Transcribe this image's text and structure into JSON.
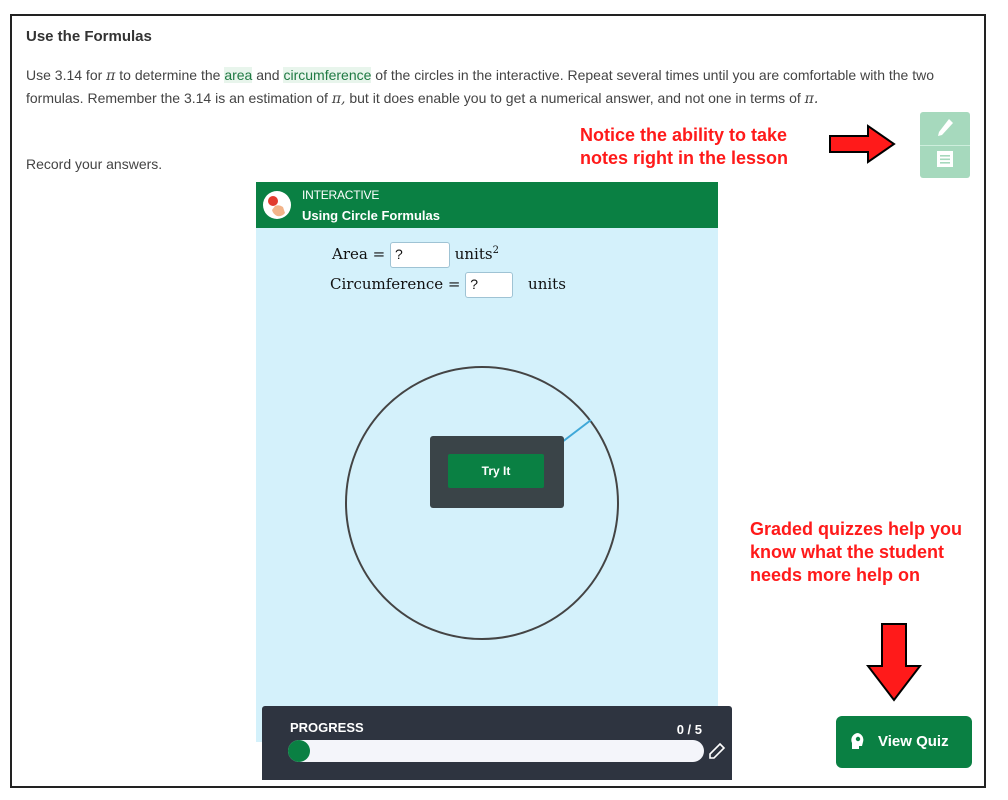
{
  "lesson": {
    "title": "Use the Formulas",
    "body_parts": {
      "p1": "Use 3.14 for ",
      "pi1": "π",
      "p2": " to determine the ",
      "link_area": "area",
      "p3": " and ",
      "link_circ": "circumference",
      "p4": " of the circles in the interactive. Repeat several times until you are comfortable with the two formulas. Remember the 3.14 is an estimation of ",
      "pi2": "π,",
      "p5": "  but it does enable you to get a numerical answer, and not one in terms of ",
      "pi3": "π.",
      "p6": ""
    },
    "record": "Record your answers."
  },
  "note_tools": {
    "pencil_icon": "pencil-icon",
    "note_icon": "note-icon"
  },
  "annotations": {
    "notes": "Notice the ability to take notes right in the lesson",
    "quiz": "Graded quizzes help you know what the student needs more help on",
    "color": "#ff1a1a"
  },
  "interactive": {
    "kicker": "INTERACTIVE",
    "name": "Using Circle Formulas",
    "area_label": "Area =",
    "area_value": "?",
    "area_unit": "units",
    "area_exp": "2",
    "circ_label": "Circumference =",
    "circ_value": "?",
    "circ_unit": "units",
    "try_label": "Try It"
  },
  "progress": {
    "label": "PROGRESS",
    "count": "0 / 5",
    "completed": 0,
    "total": 5
  },
  "quiz": {
    "label": "View Quiz"
  },
  "colors": {
    "brand_green": "#0a8043",
    "panel_bg": "#d4f1fb",
    "progress_bg": "#2e3440"
  }
}
